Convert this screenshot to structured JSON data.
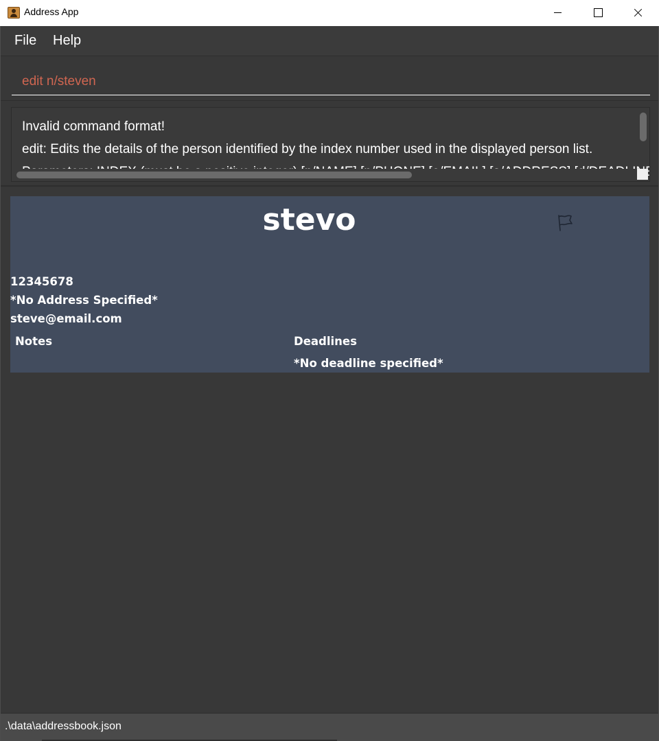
{
  "window": {
    "title": "Address App"
  },
  "menu": {
    "items": [
      {
        "label": "File"
      },
      {
        "label": "Help"
      }
    ]
  },
  "command_box": {
    "value": "edit n/steven"
  },
  "result_display": {
    "text": "Invalid command format!\nedit: Edits the details of the person identified by the index number used in the displayed person list.\nParameters: INDEX (must be a positive integer) [n/NAME] [p/PHONE] [e/EMAIL] [a/ADDRESS] [d/DEADLINE]"
  },
  "person_list": {
    "persons": [
      {
        "name": "stevo",
        "phone": "12345678",
        "address": "*No Address Specified*",
        "email": "steve@email.com",
        "notes_header": "Notes",
        "deadlines_header": "Deadlines",
        "deadline": "*No deadline specified*",
        "flag_icon": "flag-outline-icon"
      }
    ]
  },
  "status_bar": {
    "save_location": ".\\data\\addressbook.json"
  },
  "colors": {
    "background": "#383838",
    "card": "#424c5e",
    "command_text": "#d06651",
    "text": "#ffffff"
  }
}
